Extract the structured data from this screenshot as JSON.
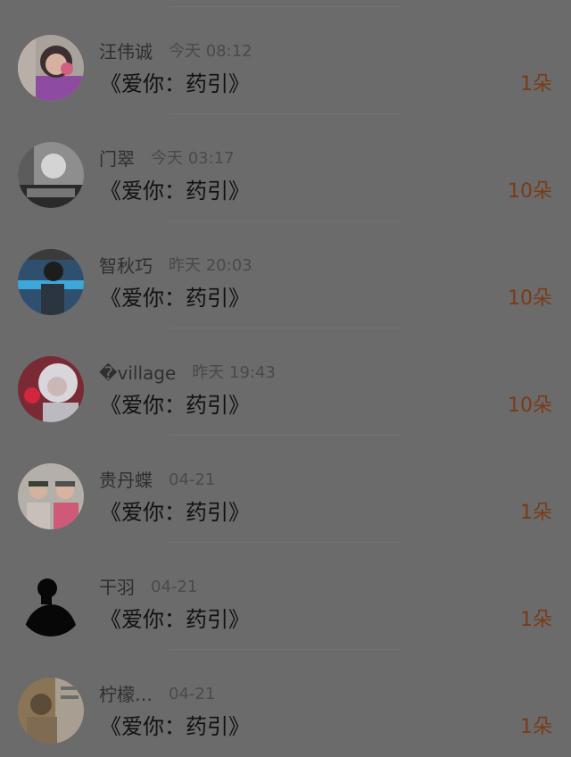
{
  "gifts": [
    {
      "sender": "汪伟诚",
      "time": "今天 08:12",
      "song": "《爱你：药引》",
      "count": "1朵",
      "avatar_icon": "user-avatar-pink-icon"
    },
    {
      "sender": "门翠",
      "time": "今天 03:17",
      "song": "《爱你：药引》",
      "count": "10朵",
      "avatar_icon": "user-avatar-monochrome-icon"
    },
    {
      "sender": "智秋巧",
      "time": "昨天 20:03",
      "song": "《爱你：药引》",
      "count": "10朵",
      "avatar_icon": "user-avatar-blue-icon"
    },
    {
      "sender": "�village",
      "time": "昨天 19:43",
      "song": "《爱你：药引》",
      "count": "10朵",
      "avatar_icon": "user-avatar-red-white-icon"
    },
    {
      "sender": "贵丹蝶",
      "time": "04-21",
      "song": "《爱你：药引》",
      "count": "1朵",
      "avatar_icon": "user-avatar-couple-icon"
    },
    {
      "sender": "干羽",
      "time": "04-21",
      "song": "《爱你：药引》",
      "count": "1朵",
      "avatar_icon": "user-avatar-silhouette-icon"
    },
    {
      "sender": "柠檬…",
      "time": "04-21",
      "song": "《爱你：药引》",
      "count": "1朵",
      "avatar_icon": "user-avatar-brown-icon"
    }
  ],
  "colors": {
    "overlay_background": "#6b6b6b",
    "count_accent": "#7a3b17"
  }
}
